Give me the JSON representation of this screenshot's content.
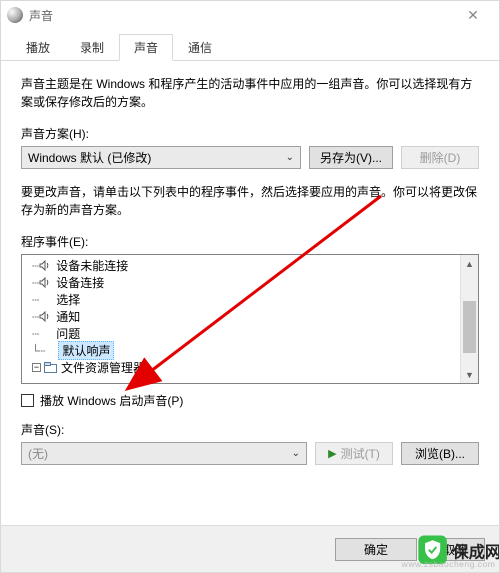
{
  "window": {
    "title": "声音"
  },
  "tabs": {
    "playback": "播放",
    "recording": "录制",
    "sounds": "声音",
    "comm": "通信"
  },
  "desc1": "声音主题是在 Windows 和程序产生的活动事件中应用的一组声音。你可以选择现有方案或保存修改后的方案。",
  "scheme_label": "声音方案(H):",
  "scheme_value": "Windows 默认 (已修改)",
  "btn_save_as": "另存为(V)...",
  "btn_delete": "删除(D)",
  "desc2": "要更改声音，请单击以下列表中的程序事件，然后选择要应用的声音。你可以将更改保存为新的声音方案。",
  "events_label": "程序事件(E):",
  "events": {
    "e0": "设备未能连接",
    "e1": "设备连接",
    "e2": "选择",
    "e3": "通知",
    "e4": "问题",
    "e5": "默认响声",
    "e6": "文件资源管理器"
  },
  "chk_play_startup": "播放 Windows 启动声音(P)",
  "sound_label": "声音(S):",
  "sound_value": "(无)",
  "btn_test": "测试(T)",
  "btn_browse": "浏览(B)...",
  "footer": {
    "ok": "确定",
    "cancel": "取消"
  },
  "watermark": {
    "text": "保成网",
    "url": "www.zsbaocheng.com"
  }
}
